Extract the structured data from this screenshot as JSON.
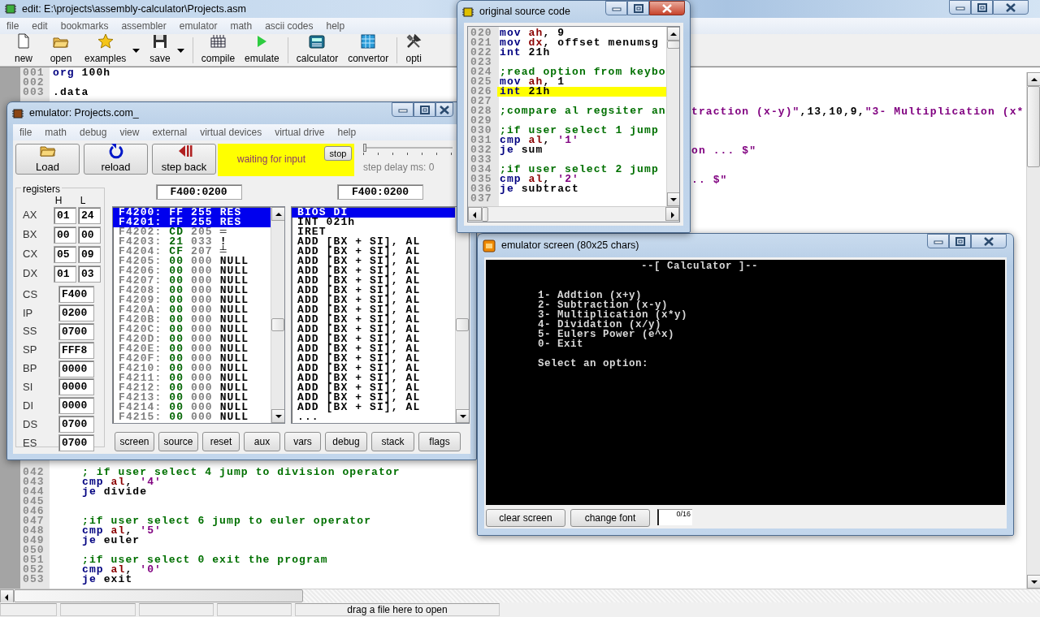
{
  "main_window": {
    "title": "edit: E:\\projects\\assembly-calculator\\Projects.asm",
    "active": false,
    "menu": [
      "file",
      "edit",
      "bookmarks",
      "assembler",
      "emulator",
      "math",
      "ascii codes",
      "help"
    ],
    "toolbar": [
      {
        "items": [
          {
            "label": "new",
            "kind": "new",
            "dropdown": false
          },
          {
            "label": "open",
            "kind": "open",
            "dropdown": false
          },
          {
            "label": "examples",
            "kind": "examples",
            "dropdown": true
          },
          {
            "label": "save",
            "kind": "save",
            "dropdown": true
          }
        ]
      },
      {
        "items": [
          {
            "label": "compile",
            "kind": "compile",
            "dropdown": false
          },
          {
            "label": "emulate",
            "kind": "emulate",
            "dropdown": false
          }
        ]
      },
      {
        "items": [
          {
            "label": "calculator",
            "kind": "calculator",
            "dropdown": false
          },
          {
            "label": "convertor",
            "kind": "convertor",
            "dropdown": false
          }
        ]
      },
      {
        "items": [
          {
            "label": "opti",
            "kind": "options",
            "dropdown": false
          }
        ]
      }
    ],
    "editor": {
      "top_lines": [
        {
          "number": "001",
          "segments": [
            {
              "text": "org",
              "kind": "keyword"
            },
            {
              "text": " 100h",
              "kind": "plain"
            }
          ]
        },
        {
          "number": "002"
        },
        {
          "number": "003",
          "segments": [
            {
              "text": ".data",
              "kind": "plain"
            }
          ]
        }
      ],
      "fragments": [
        {
          "segments": [
            {
              "text": "traction (x-y)\"",
              "kind": "string"
            },
            {
              "text": ",13,10,9,",
              "kind": "plain"
            },
            {
              "text": "\"3- Multiplication (x*",
              "kind": "string"
            }
          ]
        },
        {
          "segments": [
            {
              "text": "on ... $\"",
              "kind": "string"
            }
          ]
        },
        {
          "segments": [
            {
              "text": ".. $\"",
              "kind": "string"
            }
          ]
        }
      ],
      "bottom_lines": [
        {
          "number": "042",
          "segments": [
            {
              "text": "; if user select 4 jump to division operator",
              "kind": "comment"
            }
          ]
        },
        {
          "number": "043",
          "segments": [
            {
              "text": "cmp",
              "kind": "keyword"
            },
            {
              "text": " al",
              "kind": "register"
            },
            {
              "text": ", ",
              "kind": "plain"
            },
            {
              "text": "'4'",
              "kind": "string"
            }
          ]
        },
        {
          "number": "044",
          "segments": [
            {
              "text": "je",
              "kind": "keyword"
            },
            {
              "text": " divide",
              "kind": "plain"
            }
          ]
        },
        {
          "number": "045"
        },
        {
          "number": "046"
        },
        {
          "number": "047",
          "segments": [
            {
              "text": ";if user select 6 jump to euler operator",
              "kind": "comment"
            }
          ]
        },
        {
          "number": "048",
          "segments": [
            {
              "text": "cmp",
              "kind": "keyword"
            },
            {
              "text": " al",
              "kind": "register"
            },
            {
              "text": ", ",
              "kind": "plain"
            },
            {
              "text": "'5'",
              "kind": "string"
            }
          ]
        },
        {
          "number": "049",
          "segments": [
            {
              "text": "je",
              "kind": "keyword"
            },
            {
              "text": " euler",
              "kind": "plain"
            }
          ]
        },
        {
          "number": "050"
        },
        {
          "number": "051",
          "segments": [
            {
              "text": ";if user select 0 exit the program",
              "kind": "comment"
            }
          ]
        },
        {
          "number": "052",
          "segments": [
            {
              "text": "cmp",
              "kind": "keyword"
            },
            {
              "text": " al",
              "kind": "register"
            },
            {
              "text": ", ",
              "kind": "plain"
            },
            {
              "text": "'0'",
              "kind": "string"
            }
          ]
        },
        {
          "number": "053",
          "segments": [
            {
              "text": "je",
              "kind": "keyword"
            },
            {
              "text": " exit",
              "kind": "plain"
            }
          ]
        }
      ]
    },
    "status_bar": {
      "message": "drag a file here to open"
    }
  },
  "emulator": {
    "title": "emulator: Projects.com_",
    "active": false,
    "menu": [
      "file",
      "math",
      "debug",
      "view",
      "external",
      "virtual devices",
      "virtual drive",
      "help"
    ],
    "buttons": [
      {
        "label": "Load",
        "kind": "load"
      },
      {
        "label": "reload",
        "kind": "reload"
      },
      {
        "label": "step back",
        "kind": "step_back"
      }
    ],
    "status": {
      "text": "waiting for input",
      "stop_label": "stop"
    },
    "step_delay": {
      "label": "step delay ms: 0",
      "level": 0
    },
    "registers": {
      "title": "registers",
      "h_label": "H",
      "l_label": "L",
      "pairs": [
        {
          "name": "AX",
          "h": "01",
          "l": "24"
        },
        {
          "name": "BX",
          "h": "00",
          "l": "00"
        },
        {
          "name": "CX",
          "h": "05",
          "l": "09"
        },
        {
          "name": "DX",
          "h": "01",
          "l": "03"
        }
      ],
      "words": [
        {
          "name": "CS",
          "value": "F400"
        },
        {
          "name": "IP",
          "value": "0200"
        },
        {
          "name": "SS",
          "value": "0700"
        },
        {
          "name": "SP",
          "value": "FFF8"
        },
        {
          "name": "BP",
          "value": "0000"
        },
        {
          "name": "SI",
          "value": "0000"
        },
        {
          "name": "DI",
          "value": "0000"
        },
        {
          "name": "DS",
          "value": "0700"
        },
        {
          "name": "ES",
          "value": "0700"
        }
      ]
    },
    "memory": {
      "address": "F400:0200",
      "rows": [
        {
          "address": "F4200:",
          "hex": "FF",
          "dec": "255",
          "char": "RES",
          "selected": true
        },
        {
          "address": "F4201:",
          "hex": "FF",
          "dec": "255",
          "char": "RES",
          "selected": true
        },
        {
          "address": "F4202:",
          "hex": "CD",
          "dec": "205",
          "char": "═",
          "selected": false
        },
        {
          "address": "F4203:",
          "hex": "21",
          "dec": "033",
          "char": "!",
          "selected": false
        },
        {
          "address": "F4204:",
          "hex": "CF",
          "dec": "207",
          "char": "╧",
          "selected": false
        },
        {
          "address": "F4205:",
          "hex": "00",
          "dec": "000",
          "char": "NULL",
          "selected": false
        },
        {
          "address": "F4206:",
          "hex": "00",
          "dec": "000",
          "char": "NULL",
          "selected": false
        },
        {
          "address": "F4207:",
          "hex": "00",
          "dec": "000",
          "char": "NULL",
          "selected": false
        },
        {
          "address": "F4208:",
          "hex": "00",
          "dec": "000",
          "char": "NULL",
          "selected": false
        },
        {
          "address": "F4209:",
          "hex": "00",
          "dec": "000",
          "char": "NULL",
          "selected": false
        },
        {
          "address": "F420A:",
          "hex": "00",
          "dec": "000",
          "char": "NULL",
          "selected": false
        },
        {
          "address": "F420B:",
          "hex": "00",
          "dec": "000",
          "char": "NULL",
          "selected": false
        },
        {
          "address": "F420C:",
          "hex": "00",
          "dec": "000",
          "char": "NULL",
          "selected": false
        },
        {
          "address": "F420D:",
          "hex": "00",
          "dec": "000",
          "char": "NULL",
          "selected": false
        },
        {
          "address": "F420E:",
          "hex": "00",
          "dec": "000",
          "char": "NULL",
          "selected": false
        },
        {
          "address": "F420F:",
          "hex": "00",
          "dec": "000",
          "char": "NULL",
          "selected": false
        },
        {
          "address": "F4210:",
          "hex": "00",
          "dec": "000",
          "char": "NULL",
          "selected": false
        },
        {
          "address": "F4211:",
          "hex": "00",
          "dec": "000",
          "char": "NULL",
          "selected": false
        },
        {
          "address": "F4212:",
          "hex": "00",
          "dec": "000",
          "char": "NULL",
          "selected": false
        },
        {
          "address": "F4213:",
          "hex": "00",
          "dec": "000",
          "char": "NULL",
          "selected": false
        },
        {
          "address": "F4214:",
          "hex": "00",
          "dec": "000",
          "char": "NULL",
          "selected": false
        },
        {
          "address": "F4215:",
          "hex": "00",
          "dec": "000",
          "char": "NULL",
          "selected": false
        }
      ]
    },
    "disassembly": {
      "address": "F400:0200",
      "rows": [
        {
          "text": "BIOS DI",
          "selected": true
        },
        {
          "text": "INT 021h",
          "selected": false
        },
        {
          "text": "IRET",
          "selected": false
        },
        {
          "text": "ADD [BX + SI], AL",
          "selected": false
        },
        {
          "text": "ADD [BX + SI], AL",
          "selected": false
        },
        {
          "text": "ADD [BX + SI], AL",
          "selected": false
        },
        {
          "text": "ADD [BX + SI], AL",
          "selected": false
        },
        {
          "text": "ADD [BX + SI], AL",
          "selected": false
        },
        {
          "text": "ADD [BX + SI], AL",
          "selected": false
        },
        {
          "text": "ADD [BX + SI], AL",
          "selected": false
        },
        {
          "text": "ADD [BX + SI], AL",
          "selected": false
        },
        {
          "text": "ADD [BX + SI], AL",
          "selected": false
        },
        {
          "text": "ADD [BX + SI], AL",
          "selected": false
        },
        {
          "text": "ADD [BX + SI], AL",
          "selected": false
        },
        {
          "text": "ADD [BX + SI], AL",
          "selected": false
        },
        {
          "text": "ADD [BX + SI], AL",
          "selected": false
        },
        {
          "text": "ADD [BX + SI], AL",
          "selected": false
        },
        {
          "text": "ADD [BX + SI], AL",
          "selected": false
        },
        {
          "text": "ADD [BX + SI], AL",
          "selected": false
        },
        {
          "text": "ADD [BX + SI], AL",
          "selected": false
        },
        {
          "text": "ADD [BX + SI], AL",
          "selected": false
        },
        {
          "text": "...",
          "selected": false
        }
      ]
    },
    "bottom_buttons": [
      "screen",
      "source",
      "reset",
      "aux",
      "vars",
      "debug",
      "stack",
      "flags"
    ]
  },
  "source_window": {
    "title": "original source code",
    "active": true,
    "lines": [
      {
        "number": "020",
        "highlighted": false,
        "segments": [
          {
            "text": "mov",
            "kind": "keyword"
          },
          {
            "text": " ah",
            "kind": "register"
          },
          {
            "text": ", 9",
            "kind": "plain"
          }
        ]
      },
      {
        "number": "021",
        "highlighted": false,
        "segments": [
          {
            "text": "mov",
            "kind": "keyword"
          },
          {
            "text": " dx",
            "kind": "register"
          },
          {
            "text": ", offset menumsg",
            "kind": "plain"
          }
        ]
      },
      {
        "number": "022",
        "highlighted": false,
        "segments": [
          {
            "text": "int",
            "kind": "keyword"
          },
          {
            "text": " 21h",
            "kind": "plain"
          }
        ]
      },
      {
        "number": "023",
        "highlighted": false
      },
      {
        "number": "024",
        "highlighted": false,
        "segments": [
          {
            "text": ";read option from keybo",
            "kind": "comment"
          }
        ]
      },
      {
        "number": "025",
        "highlighted": false,
        "segments": [
          {
            "text": "mov",
            "kind": "keyword"
          },
          {
            "text": " ah",
            "kind": "register"
          },
          {
            "text": ", 1",
            "kind": "plain"
          }
        ]
      },
      {
        "number": "026",
        "highlighted": true,
        "segments": [
          {
            "text": "int",
            "kind": "keyword"
          },
          {
            "text": " 21h",
            "kind": "plain"
          }
        ]
      },
      {
        "number": "027",
        "highlighted": false
      },
      {
        "number": "028",
        "highlighted": false,
        "segments": [
          {
            "text": ";compare al regsiter an",
            "kind": "comment"
          }
        ]
      },
      {
        "number": "029",
        "highlighted": false
      },
      {
        "number": "030",
        "highlighted": false,
        "segments": [
          {
            "text": ";if user select 1 jump",
            "kind": "comment"
          }
        ]
      },
      {
        "number": "031",
        "highlighted": false,
        "segments": [
          {
            "text": "cmp",
            "kind": "keyword"
          },
          {
            "text": " al",
            "kind": "register"
          },
          {
            "text": ", ",
            "kind": "plain"
          },
          {
            "text": "'1'",
            "kind": "string"
          }
        ]
      },
      {
        "number": "032",
        "highlighted": false,
        "segments": [
          {
            "text": "je",
            "kind": "keyword"
          },
          {
            "text": " sum",
            "kind": "plain"
          }
        ]
      },
      {
        "number": "033",
        "highlighted": false
      },
      {
        "number": "034",
        "highlighted": false,
        "segments": [
          {
            "text": ";if user select 2 jump",
            "kind": "comment"
          }
        ]
      },
      {
        "number": "035",
        "highlighted": false,
        "segments": [
          {
            "text": "cmp",
            "kind": "keyword"
          },
          {
            "text": " al",
            "kind": "register"
          },
          {
            "text": ", ",
            "kind": "plain"
          },
          {
            "text": "'2'",
            "kind": "string"
          }
        ]
      },
      {
        "number": "036",
        "highlighted": false,
        "segments": [
          {
            "text": "je",
            "kind": "keyword"
          },
          {
            "text": " subtract",
            "kind": "plain"
          }
        ]
      },
      {
        "number": "037",
        "highlighted": false
      }
    ]
  },
  "screen_window": {
    "title": "emulator screen (80x25 chars)",
    "active": false,
    "lines": [
      {
        "text": "--[ Calculator ]--",
        "kind": "title"
      },
      {
        "text": "1- Addtion (x+y)",
        "kind": "item"
      },
      {
        "text": "2- Subtraction (x-y)",
        "kind": "item"
      },
      {
        "text": "3- Multiplication (x*y)",
        "kind": "item"
      },
      {
        "text": "4- Dividation (x/y)",
        "kind": "item"
      },
      {
        "text": "5- Eulers Power (e^x)",
        "kind": "item"
      },
      {
        "text": "0- Exit",
        "kind": "item"
      },
      {
        "text": "Select an option:",
        "kind": "prompt"
      }
    ],
    "buttons": [
      "clear screen",
      "change font"
    ],
    "counter": "0/16"
  }
}
